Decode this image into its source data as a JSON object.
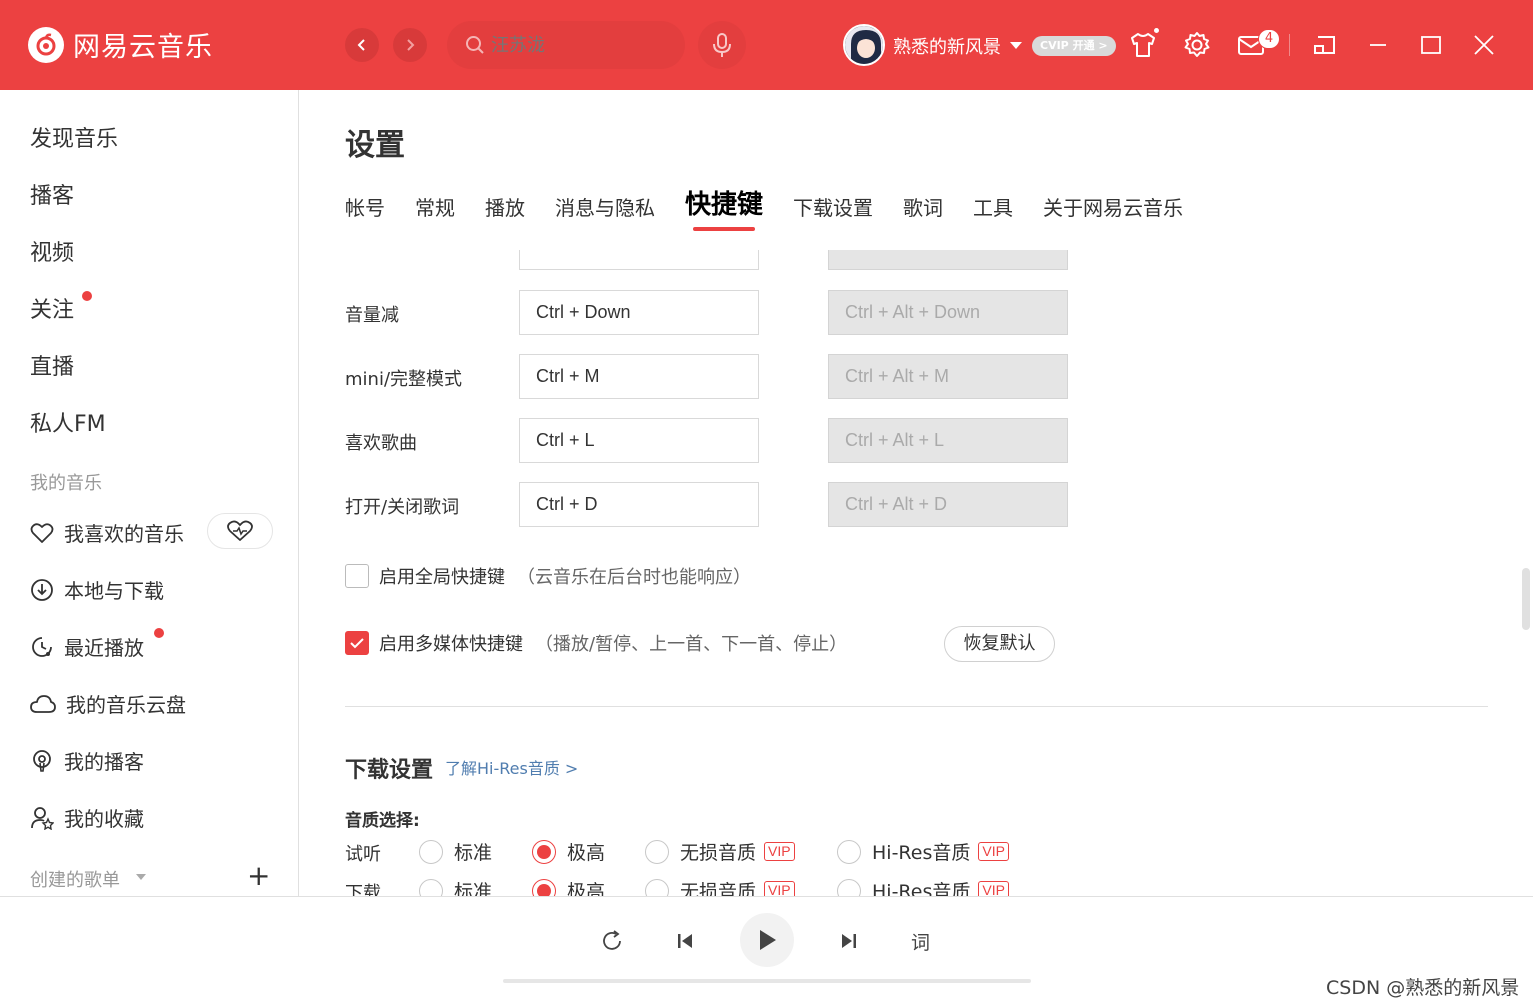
{
  "app": {
    "logo_text": "网易云音乐",
    "search_placeholder": "汪苏泷",
    "username": "熟悉的新风景",
    "vip_badge": "CVIP 开通 >",
    "message_count": "4",
    "accent_color": "#ec4141"
  },
  "sidebar": {
    "top_items": [
      {
        "label": "发现音乐"
      },
      {
        "label": "播客"
      },
      {
        "label": "视频"
      },
      {
        "label": "关注",
        "dot": true
      },
      {
        "label": "直播"
      },
      {
        "label": "私人FM"
      }
    ],
    "my_music_title": "我的音乐",
    "my_music_items": [
      {
        "label": "我喜欢的音乐",
        "icon": "heart-icon"
      },
      {
        "label": "本地与下载",
        "icon": "download-icon"
      },
      {
        "label": "最近播放",
        "icon": "clock-icon",
        "dot": true
      },
      {
        "label": "我的音乐云盘",
        "icon": "cloud-icon"
      },
      {
        "label": "我的播客",
        "icon": "podcast-icon"
      },
      {
        "label": "我的收藏",
        "icon": "collect-icon"
      }
    ],
    "created_playlists_title": "创建的歌单"
  },
  "settings": {
    "title": "设置",
    "tabs": [
      "帐号",
      "常规",
      "播放",
      "消息与隐私",
      "快捷键",
      "下载设置",
      "歌词",
      "工具",
      "关于网易云音乐"
    ],
    "active_tab": "快捷键",
    "shortcuts": [
      {
        "label": "音量减",
        "local": "Ctrl + Down",
        "global": "Ctrl + Alt + Down"
      },
      {
        "label": "mini/完整模式",
        "local": "Ctrl + M",
        "global": "Ctrl + Alt + M"
      },
      {
        "label": "喜欢歌曲",
        "local": "Ctrl + L",
        "global": "Ctrl + Alt + L"
      },
      {
        "label": "打开/关闭歌词",
        "local": "Ctrl + D",
        "global": "Ctrl + Alt + D"
      }
    ],
    "global_shortcut": {
      "label": "启用全局快捷键",
      "note": "（云音乐在后台时也能响应）",
      "checked": false
    },
    "media_shortcut": {
      "label": "启用多媒体快捷键",
      "note": "（播放/暂停、上一首、下一首、停止）",
      "checked": true
    },
    "restore_default": "恢复默认",
    "download_section": {
      "title": "下载设置",
      "link": "了解Hi-Res音质 >",
      "quality_label": "音质选择:",
      "rows": [
        {
          "label": "试听",
          "selected": "极高"
        },
        {
          "label": "下载",
          "selected": "极高"
        }
      ],
      "options": [
        {
          "label": "标准",
          "vip": ""
        },
        {
          "label": "极高",
          "vip": ""
        },
        {
          "label": "无损音质",
          "vip": "VIP"
        },
        {
          "label": "Hi-Res音质",
          "vip": "VIP"
        }
      ]
    }
  },
  "player": {
    "lyric_label": "词"
  },
  "watermark": "CSDN @熟悉的新风景"
}
